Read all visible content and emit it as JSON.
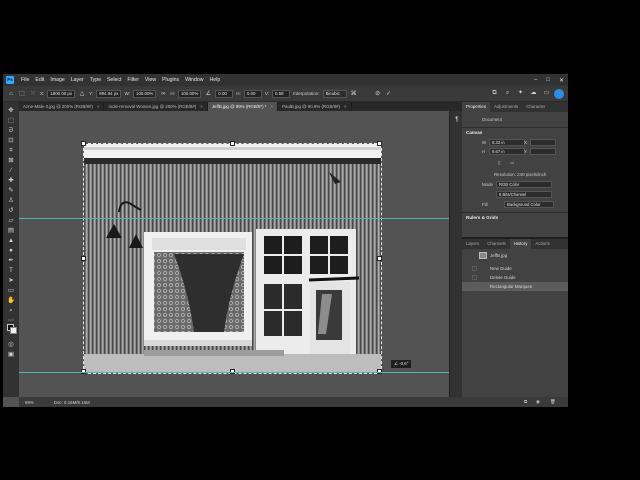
{
  "menu": {
    "logo": "Ps",
    "items": [
      "File",
      "Edit",
      "Image",
      "Layer",
      "Type",
      "Select",
      "Filter",
      "View",
      "Plugins",
      "Window",
      "Help"
    ]
  },
  "options_bar": {
    "x_label": "X:",
    "x_value": "1800.00 px",
    "y_label": "Y:",
    "y_value": "994.94 px",
    "w_label": "W:",
    "w_value": "100.00%",
    "h_label": "H:",
    "h_value": "100.00%",
    "angle_value": "0.00",
    "hskew_label": "H:",
    "hskew_value": "0.00",
    "vskew_label": "V:",
    "vskew_value": "0.58",
    "interp_label": "Interpolation:",
    "interp_value": "Bicubic"
  },
  "tabs": [
    {
      "label": "Azne-Male-3.jpg @ 200% (RGB/8#)",
      "active": false
    },
    {
      "label": "mole-removal Women.jpg @ 200% (RGB/8#)",
      "active": false
    },
    {
      "label": "JeffB.jpg @ 89% (RGB/8*) *",
      "active": true
    },
    {
      "label": "PaulB.jpg @ 90.9% (RGB/8#)",
      "active": false
    }
  ],
  "transform_tip": "∠ -0.6°",
  "status": {
    "zoom": "89%",
    "doc": "Doc: 9.16M/9.16M"
  },
  "properties_panel": {
    "tabs": [
      "Properties",
      "Adjustments",
      "Character"
    ],
    "doc_label": "Document",
    "canvas_heading": "Canvas",
    "w_label": "W",
    "w_value": "8.33 in",
    "h_label": "H",
    "h_value": "6.67 in",
    "x_label": "X",
    "y_label": "Y",
    "resolution": "Resolution: 240 pixels/inch",
    "mode_label": "Mode",
    "mode_value": "RGB Color",
    "bit_value": "8 Bits/Channel",
    "fill_label": "Fill",
    "fill_value": "Background Color",
    "rulers_heading": "Rulers & Grids"
  },
  "history_panel": {
    "tabs": [
      "Layers",
      "Channels",
      "History",
      "Actions"
    ],
    "snapshot": "JeffB.jpg",
    "items": [
      "New Guide",
      "Delete Guide",
      "Rectangular Marquee"
    ],
    "active_index": 2
  },
  "colors": {
    "accent": "#31a8ff",
    "guide": "#4fb6b2",
    "panel": "#424242",
    "workspace": "#535353"
  }
}
